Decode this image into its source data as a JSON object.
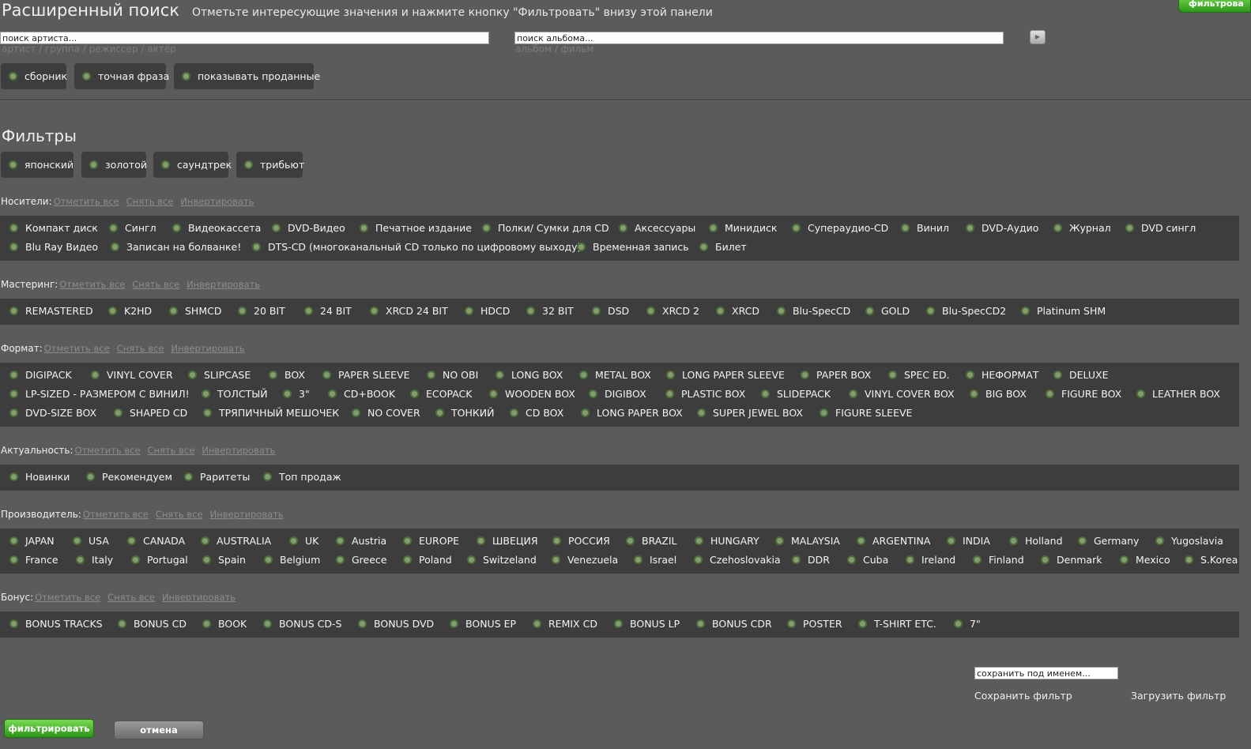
{
  "header": {
    "title": "Расширенный поиск",
    "subtitle": "Отметьте интересующие значения и нажмите кнопку \"Фильтровать\" внизу этой панели",
    "top_button": "фильтрова"
  },
  "search": {
    "artist_placeholder": "поиск артиста...",
    "artist_hint": "артист / группа / режиссер / актёр",
    "album_placeholder": "поиск альбома...",
    "album_hint": "альбом / фильм"
  },
  "options": [
    "сборник",
    "точная фраза",
    "показывать проданные"
  ],
  "filters": {
    "title": "Фильтры",
    "quick": [
      "японский",
      "золотой",
      "саундтрек",
      "трибьют"
    ]
  },
  "links": {
    "check_all": "Отметить все",
    "uncheck_all": "Снять все",
    "invert": "Инвертировать"
  },
  "categories": [
    {
      "label": "Носители:",
      "rows": [
        [
          "Компакт диск",
          "Сингл",
          "Видеокассета",
          "DVD-Видео",
          "Печатное издание",
          "Полки/ Сумки для CD",
          "Аксессуары",
          "Минидиск",
          "Супераудио-CD",
          "Винил",
          "DVD-Аудио",
          "Журнал",
          "DVD сингл"
        ],
        [
          "Blu Ray Видео",
          "Записан на болванке!",
          "DTS-CD (многоканальный CD только по цифровому выходу)",
          "Временная запись",
          "Билет"
        ]
      ]
    },
    {
      "label": "Мастеринг:",
      "rows": [
        [
          "REMASTERED",
          "K2HD",
          "SHMCD",
          "20 BIT",
          "24 BIT",
          "XRCD 24 BIT",
          "HDCD",
          "32 BIT",
          "DSD",
          "XRCD 2",
          "XRCD",
          "Blu-SpecCD",
          "GOLD",
          "Blu-SpecCD2",
          "Platinum SHM"
        ]
      ]
    },
    {
      "label": "Формат:",
      "rows": [
        [
          "DIGIPACK",
          "VINYL COVER",
          "SLIPCASE",
          "BOX",
          "PAPER SLEEVE",
          "NO OBI",
          "LONG BOX",
          "METAL BOX",
          "LONG PAPER SLEEVE",
          "PAPER BOX",
          "SPEC ED.",
          "НЕФОРМАТ",
          "DELUXE"
        ],
        [
          "LP-SIZED - РАЗМЕРОМ С ВИНИЛ!",
          "ТОЛСТЫЙ",
          "3\"",
          "CD+BOOK",
          "ECOPACK",
          "WOODEN BOX",
          "DIGIBOX",
          "PLASTIC BOX",
          "SLIDEPACK",
          "VINYL COVER BOX",
          "BIG BOX",
          "FIGURE BOX",
          "LEATHER BOX"
        ],
        [
          "DVD-SIZE BOX",
          "SHAPED CD",
          "ТРЯПИЧНЫЙ МЕШОЧЕК",
          "NO COVER",
          "ТОНКИЙ",
          "CD BOX",
          "LONG PAPER BOX",
          "SUPER JEWEL BOX",
          "FIGURE SLEEVE"
        ]
      ]
    },
    {
      "label": "Актуальность:",
      "rows": [
        [
          "Новинки",
          "Рекомендуем",
          "Раритеты",
          "Топ продаж"
        ]
      ]
    },
    {
      "label": "Производитель:",
      "rows": [
        [
          "JAPAN",
          "USA",
          "CANADA",
          "AUSTRALIA",
          "UK",
          "Austria",
          "EUROPE",
          "ШВЕЦИЯ",
          "РОССИЯ",
          "BRAZIL",
          "HUNGARY",
          "MALAYSIA",
          "ARGENTINA",
          "INDIA",
          "Holland",
          "Germany",
          "Yugoslavia"
        ],
        [
          "France",
          "Italy",
          "Portugal",
          "Spain",
          "Belgium",
          "Greece",
          "Poland",
          "Switzeland",
          "Venezuela",
          "Israel",
          "Czehoslovakia",
          "DDR",
          "Cuba",
          "Ireland",
          "Finland",
          "Denmark",
          "Mexico",
          "S.Korea"
        ]
      ]
    },
    {
      "label": "Бонус:",
      "rows": [
        [
          "BONUS TRACKS",
          "BONUS CD",
          "BOOK",
          "BONUS CD-S",
          "BONUS DVD",
          "BONUS EP",
          "REMIX CD",
          "BONUS LP",
          "BONUS CDR",
          "POSTER",
          "T-SHIRT ETC.",
          "7\""
        ]
      ]
    }
  ],
  "save": {
    "placeholder": "сохранить под именем...",
    "save_label": "Сохранить фильтр",
    "load_label": "Загрузить фильтр"
  },
  "footer": {
    "filter_button": "фильтрировать",
    "cancel_button": "отмена"
  }
}
